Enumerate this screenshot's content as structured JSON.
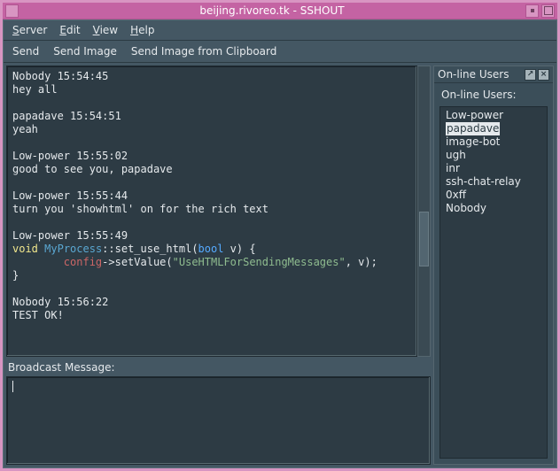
{
  "window": {
    "title": "beijing.rivoreo.tk - SSHOUT"
  },
  "menu": {
    "server": "Server",
    "edit": "Edit",
    "view": "View",
    "help": "Help"
  },
  "toolbar": {
    "send": "Send",
    "send_image": "Send Image",
    "send_clipboard": "Send Image from Clipboard"
  },
  "chat": {
    "messages": [
      {
        "header": "Nobody 15:54:45",
        "body": "hey all"
      },
      {
        "header": "papadave 15:54:51",
        "body": "yeah"
      },
      {
        "header": "Low-power 15:55:02",
        "body": "good to see you, papadave"
      },
      {
        "header": "Low-power 15:55:44",
        "body": "turn you 'showhtml' on for the rich text"
      },
      {
        "header": "Low-power 15:55:49",
        "code": {
          "kw_void": "void",
          "fn": "MyProcess",
          "sig1": "::set_use_html(",
          "argtype": "bool",
          "sig2": " v) {",
          "line2_var": "config",
          "line2_rest": "->setValue(",
          "line2_str": "\"UseHTMLForSendingMessages\"",
          "line2_tail": ", v);",
          "line3": "}"
        }
      },
      {
        "header": "Nobody 15:56:22",
        "body": "TEST OK!"
      }
    ],
    "input_label": "Broadcast Message:"
  },
  "users": {
    "panel_title": "On-line Users",
    "heading": "On-line Users:",
    "selected": "papadave",
    "list": [
      "Low-power",
      "papadave",
      "image-bot",
      "ugh",
      "inr",
      "ssh-chat-relay",
      "0xff",
      "Nobody"
    ]
  }
}
